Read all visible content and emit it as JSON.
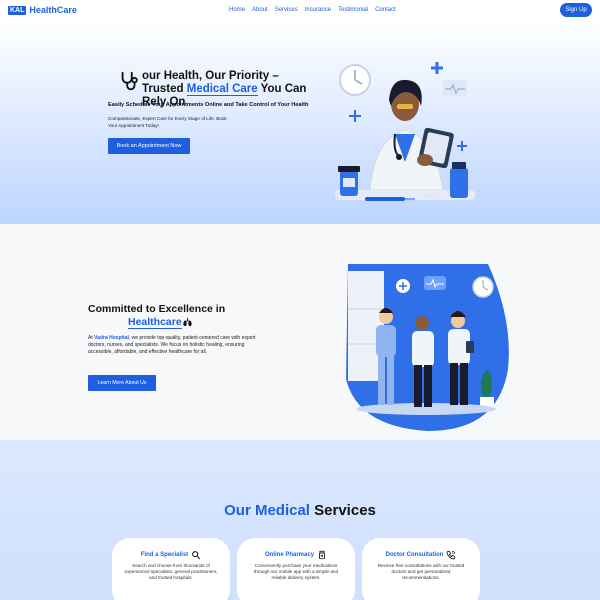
{
  "nav": {
    "logo_box": "KAL",
    "logo_text": "HealthCare",
    "links": [
      "Home",
      "About",
      "Services",
      "Insurance",
      "Testimonial",
      "Contact"
    ],
    "signup": "Sign Up"
  },
  "hero": {
    "title_part1": "our Health, Our Priority – Trusted ",
    "title_highlight": "Medical Care",
    "title_part2": " You Can Rely On",
    "subtitle": "Easily Schedule Your Appointments Online and Take Control of Your Health",
    "description": "Compassionate, Expert Care for Every Stage of Life. Book Your Appointment Today!",
    "button": "Book an Appointment Now"
  },
  "about": {
    "title_line1": "Committed to Excellence in",
    "title_highlight": "Healthcare",
    "desc_prefix": "At ",
    "desc_highlight": "Vadra Hospital",
    "desc_rest": ", we provide top-quality, patient-centered care with expert doctors, nurses, and specialists. We focus on holistic healing, ensuring accessible, affordable, and effective healthcare for all.",
    "button": "Learn More About Us"
  },
  "services": {
    "title_highlight": "Our Medical",
    "title_rest": " Services",
    "cards": [
      {
        "title": "Find a Specialist",
        "icon": "search-icon",
        "text": "Search and choose from thousands of experienced specialists, general practitioners, and trusted hospitals."
      },
      {
        "title": "Online Pharmacy",
        "icon": "medicine-bottle-icon",
        "text": "Conveniently purchase your medications through our mobile app with a simple and reliable delivery system."
      },
      {
        "title": "Doctor Consultation",
        "icon": "phone-call-icon",
        "text": "Receive free consultations with our trusted doctors and get personalized recommendations."
      }
    ]
  },
  "colors": {
    "accent": "#1d5fe0",
    "hero_bg": "#bcd4ff",
    "services_bg": "#d6e5ff"
  }
}
